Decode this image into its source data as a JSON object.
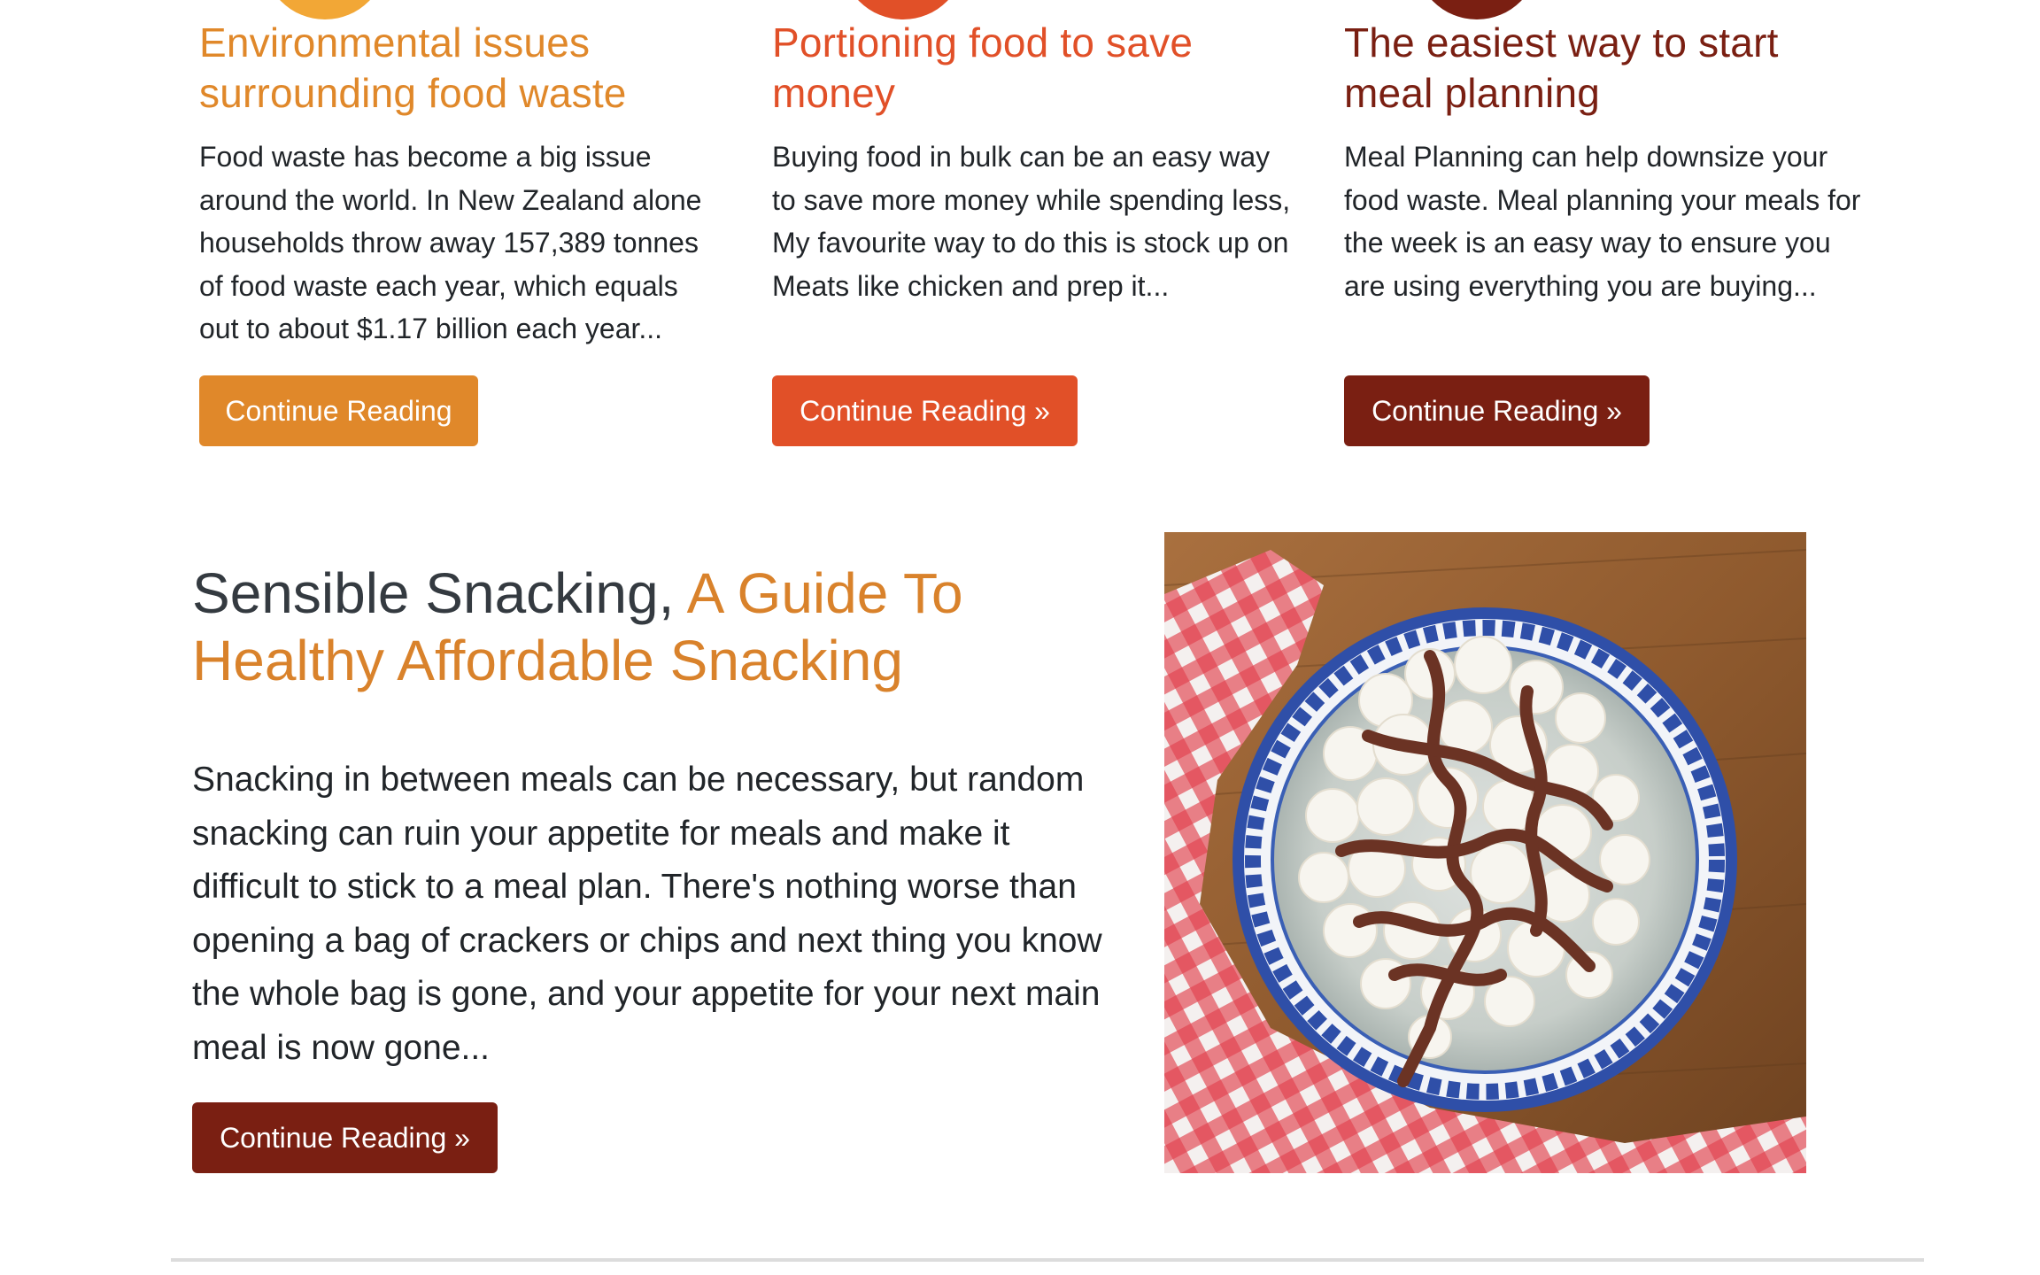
{
  "colors": {
    "orange": "#e0882a",
    "red_orange": "#e15028",
    "maroon": "#7a1f12",
    "feature_dark": "#343a40",
    "feature_accent": "#d9822b",
    "circle_1": "#f2a736",
    "circle_2": "#e15028",
    "circle_3": "#7a1f12"
  },
  "articles": [
    {
      "title": "Environmental issues surrounding food waste",
      "text": "Food waste has become a big issue around the world. In New Zealand alone households throw away 157,389 tonnes of food waste each year, which equals out to about $1.17 billion each year...",
      "button": "Continue Reading"
    },
    {
      "title": "Portioning food to save money",
      "text": "Buying food in bulk can be an easy way to save more money while spending less, My favourite way to do this is stock up on Meats like chicken and prep it...",
      "button": "Continue Reading »"
    },
    {
      "title": "The easiest way to start meal planning",
      "text": "Meal Planning can help downsize your food waste. Meal planning your meals for the week is an easy way to ensure you are using everything you are buying...",
      "button": "Continue Reading »"
    }
  ],
  "feature": {
    "title_main": "Sensible Snacking,",
    "title_highlight": "A Guide To Healthy Affordable Snacking",
    "text": "Snacking in between meals can be necessary, but random snacking can ruin your appetite for meals and make it difficult to stick to a meal plan. There's nothing worse than opening a bag of crackers or chips and next thing you know the whole bag is gone, and your appetite for your next main meal is now gone...",
    "button": "Continue Reading »",
    "image_icon": "popcorn-bowl-photo"
  }
}
